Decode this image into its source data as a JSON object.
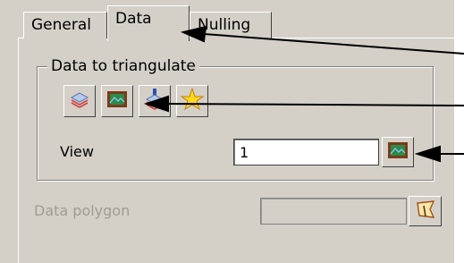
{
  "tabs": [
    {
      "label": "General",
      "active": false
    },
    {
      "label": "Data",
      "active": true
    },
    {
      "label": "Nulling",
      "active": false
    }
  ],
  "data_group": {
    "title": "Data to triangulate",
    "toolbar": [
      {
        "icon": "layers-icon"
      },
      {
        "icon": "view-icon"
      },
      {
        "icon": "stack-icon"
      },
      {
        "icon": "star-icon"
      }
    ]
  },
  "view": {
    "label": "View",
    "value": "1",
    "pick_icon": "view-icon"
  },
  "polygon": {
    "label": "Data polygon",
    "value": "",
    "pick_icon": "polygon-pick-icon",
    "disabled": true
  },
  "colors": {
    "panel": "#d4d0c8",
    "disabled_text": "#a09c94",
    "view_icon_frame": "#7a3a1a",
    "view_icon_fill": "#2e8a4a"
  }
}
